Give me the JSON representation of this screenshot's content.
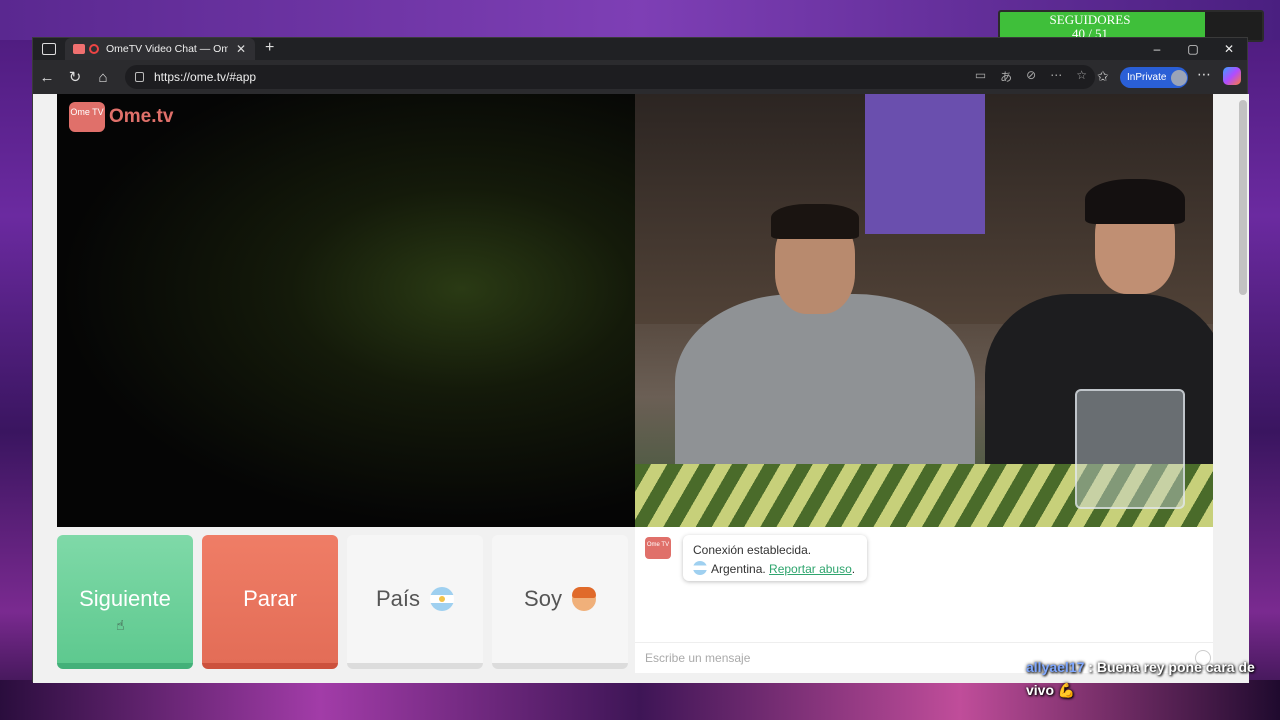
{
  "overlay": {
    "followers_label": "SEGUIDORES",
    "followers_count": "40 / 51",
    "followers_progress": 0.784
  },
  "browser": {
    "tab_title": "OmeTV Video Chat — Omeg",
    "url": "https://ome.tv/#app",
    "inprivate_label": "InPrivate",
    "controls": {
      "minimize": "–",
      "maximize": "▢",
      "close": "✕"
    }
  },
  "app": {
    "logo_text": "Ome.tv",
    "logo_badge": "Ome TV",
    "buttons": {
      "next": "Siguiente",
      "stop": "Parar",
      "country": "País",
      "gender": "Soy"
    },
    "chat": {
      "connected": "Conexión establecida.",
      "country": "Argentina.",
      "report": "Reportar abuso",
      "report_suffix": ".",
      "input_placeholder": "Escribe un mensaje"
    }
  },
  "stream_chat": {
    "user": "allyael17",
    "separator": ":",
    "message": "Buena rey pone cara de vivo 💪"
  }
}
